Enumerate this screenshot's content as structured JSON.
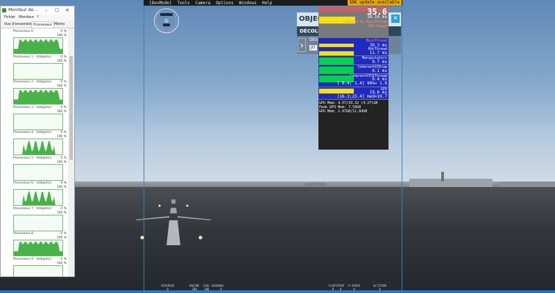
{
  "devmode_menu": {
    "items": [
      "[DevMode]",
      "Tools",
      "Camera",
      "Options",
      "Windows",
      "Help"
    ],
    "sdk_badge": "SDK update available"
  },
  "objectives": {
    "title": "OBJECT",
    "row": "DÉCOLLE",
    "detail_prefix": "DES",
    "detail_box": "JO"
  },
  "fps_overlay": {
    "fps": "35.6",
    "header_ms": "38.14 ms",
    "header_lines": [
      "Limited by MainThread",
      "CPU Usage"
    ],
    "panels": [
      {
        "label": "MainThread",
        "value": "39.3 ms",
        "bar": "yellow"
      },
      {
        "label": "RdrThread",
        "value": "11.7 ms",
        "bar": "yellow"
      },
      {
        "label": "Manipulators",
        "value": "9.7 ms",
        "bar": "green"
      },
      {
        "label": "CoherentGTDraw",
        "value": "0.1 ms",
        "bar": "green"
      },
      {
        "label": "CoherentGTUIThread",
        "value": "0.4 ms",
        "sub": "[ 0.4; 1.4] 90%= 1.0",
        "bar": "green"
      },
      {
        "label": "GPU",
        "value": "19.6 ms",
        "sub": "[16.3;23.4] med=19.7",
        "bar": "yellow"
      }
    ],
    "memory": [
      "GPU Mem: 4.57/10.32 (4.27)GB",
      "Peak GPU Mem: 7.59GB",
      "GPU Mem: 1.07GB/11.04GB"
    ]
  },
  "hud": {
    "left": [
      {
        "label": "AIRSPEED",
        "value": "0"
      },
      {
        "label": "ENGINE",
        "value": "100"
      },
      {
        "label": "FUEL",
        "value": "100"
      },
      {
        "label": "GEAR",
        "value": ""
      },
      {
        "label": "HDG",
        "value": "0"
      }
    ],
    "right": [
      {
        "label": "FLAPS",
        "value": "0"
      },
      {
        "label": "TRIM",
        "value": "0"
      },
      {
        "label": "V-SPEED",
        "value": "0"
      },
      {
        "label": "ALTITUDE",
        "value": "0"
      }
    ]
  },
  "task_manager": {
    "title": "Moniteur de...",
    "menu": [
      "Fichier",
      "Moniteur",
      "?"
    ],
    "tabs": [
      "Vue d'ensemble",
      "Processeur",
      "Mémo"
    ],
    "active_tab": "Processeur",
    "cpus": [
      {
        "name": "Processeur 0",
        "pct": "0 %",
        "max": "100 %",
        "min": "0 %",
        "profile": "high"
      },
      {
        "name": "Processeur 1 - Intégré(s)",
        "pct": "0 %",
        "max": "100 %",
        "min": "0 %",
        "profile": "flat"
      },
      {
        "name": "Processeur 2 - Intégré(s)",
        "pct": "0 %",
        "max": "100 %",
        "min": "0 %",
        "profile": "high"
      },
      {
        "name": "Processeur 3 - Intégré(s)",
        "pct": "0 %",
        "max": "100 %",
        "min": "0 %",
        "profile": "flat"
      },
      {
        "name": "Processeur 4 - Intégré(s)",
        "pct": "0 %",
        "max": "100 %",
        "min": "0 %",
        "profile": "spiky"
      },
      {
        "name": "Processeur 5 - Intégré(s)",
        "pct": "0 %",
        "max": "100 %",
        "min": "0 %",
        "profile": "flat"
      },
      {
        "name": "Processeur 6 - Intégré(s)",
        "pct": "0 %",
        "max": "100 %",
        "min": "0 %",
        "profile": "spiky"
      },
      {
        "name": "Processeur 7 - Intégré(s)",
        "pct": "0 %",
        "max": "100 %",
        "min": "0 %",
        "profile": "flat"
      },
      {
        "name": "Processeur 8",
        "pct": "0 %",
        "max": "100 %",
        "min": "0 %",
        "profile": "high"
      },
      {
        "name": "Processeur 9 - Intégré(s)",
        "pct": "0 %",
        "max": "100 %",
        "min": "0 %",
        "profile": "flat"
      }
    ]
  },
  "colors": {
    "accent": "#1d75c4",
    "fps_header": "#d25c60",
    "panel_bg": "#1f2abf",
    "bar_yellow": "#f5e10d",
    "bar_green": "#00d24a",
    "cpu_graph": "#2aa52a"
  }
}
